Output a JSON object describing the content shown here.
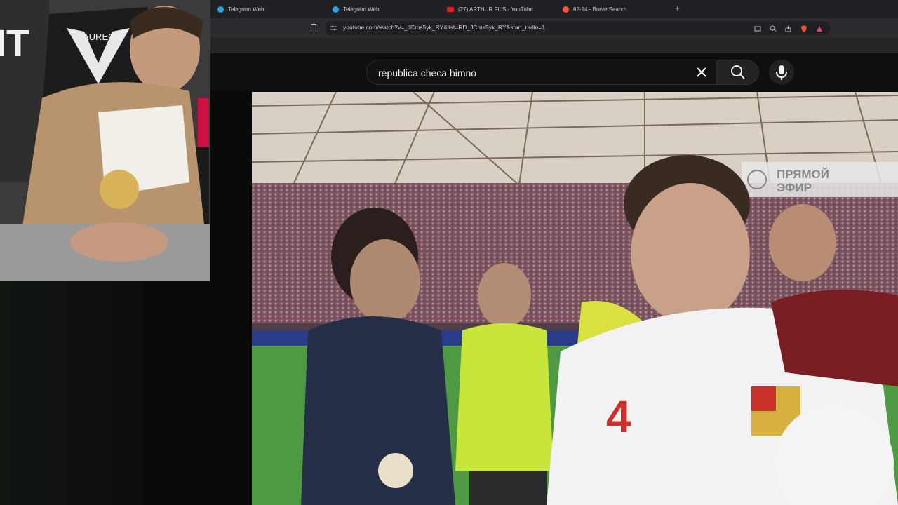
{
  "browser": {
    "tabs": [
      {
        "label": "Telegram Web",
        "favicon": "telegram-icon"
      },
      {
        "label": "Telegram Web",
        "favicon": "telegram-icon"
      },
      {
        "label": "(27) ARTHUR FILS - YouTube",
        "favicon": "youtube-icon"
      },
      {
        "label": "82-14 - Brave Search",
        "favicon": "brave-icon"
      }
    ],
    "url": "youtube.com/watch?v=_JCms5yk_RY&list=RD_JCms5yk_RY&start_radio=1"
  },
  "youtube": {
    "search_value": "republica checa himno",
    "clear_icon": "close-icon",
    "search_icon": "search-icon",
    "mic_icon": "microphone-icon"
  },
  "webcam": {
    "chair_brand": "AUREOX"
  },
  "video": {
    "broadcast_label_line1": "ПРЯМОЙ",
    "broadcast_label_line2": "ЭФИР",
    "player_number": "4"
  },
  "colors": {
    "chrome_bg": "#202124",
    "youtube_bg": "#0f0f0f",
    "referee_shirt": "#c8e63a"
  }
}
